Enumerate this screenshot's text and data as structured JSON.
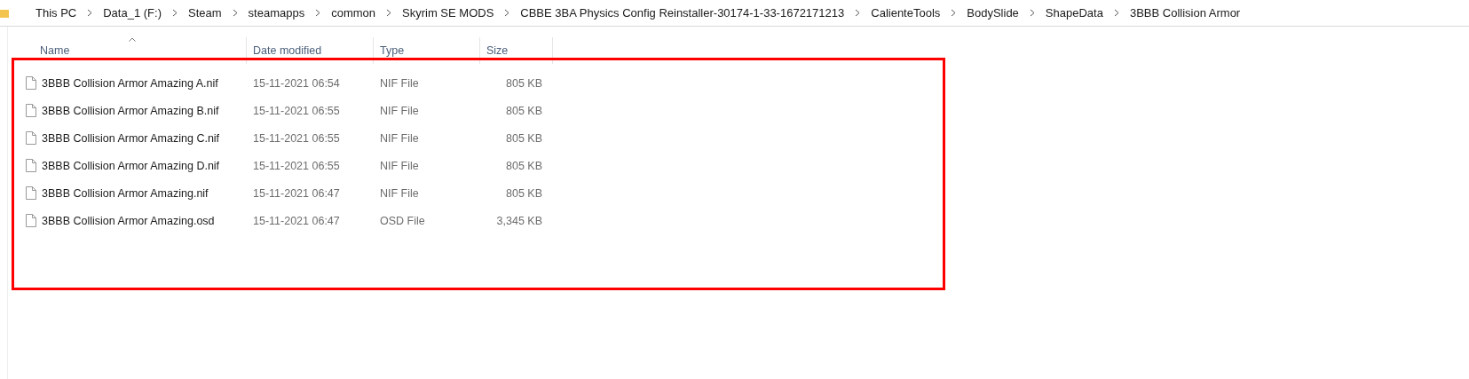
{
  "breadcrumb": [
    "This PC",
    "Data_1 (F:)",
    "Steam",
    "steamapps",
    "common",
    "Skyrim SE MODS",
    "CBBE 3BA Physics Config Reinstaller-30174-1-33-1672171213",
    "CalienteTools",
    "BodySlide",
    "ShapeData",
    "3BBB Collision Armor"
  ],
  "table": {
    "columns": [
      {
        "label": "Name",
        "sorted": true
      },
      {
        "label": "Date modified",
        "sorted": false
      },
      {
        "label": "Type",
        "sorted": false
      },
      {
        "label": "Size",
        "sorted": false
      }
    ],
    "rows": [
      {
        "name": "3BBB Collision Armor Amazing A.nif",
        "date": "15-11-2021 06:54",
        "type": "NIF File",
        "size": "805 KB"
      },
      {
        "name": "3BBB Collision Armor Amazing B.nif",
        "date": "15-11-2021 06:55",
        "type": "NIF File",
        "size": "805 KB"
      },
      {
        "name": "3BBB Collision Armor Amazing C.nif",
        "date": "15-11-2021 06:55",
        "type": "NIF File",
        "size": "805 KB"
      },
      {
        "name": "3BBB Collision Armor Amazing D.nif",
        "date": "15-11-2021 06:55",
        "type": "NIF File",
        "size": "805 KB"
      },
      {
        "name": "3BBB Collision Armor Amazing.nif",
        "date": "15-11-2021 06:47",
        "type": "NIF File",
        "size": "805 KB"
      },
      {
        "name": "3BBB Collision Armor Amazing.osd",
        "date": "15-11-2021 06:47",
        "type": "OSD File",
        "size": "3,345 KB"
      }
    ]
  },
  "annotation": {
    "color": "#ff0000"
  }
}
